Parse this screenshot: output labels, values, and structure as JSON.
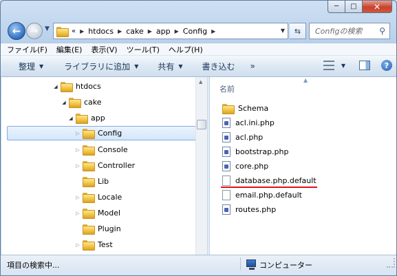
{
  "window": {
    "minimize_label": "─",
    "maximize_label": "□",
    "close_label": "✕"
  },
  "nav": {
    "back_icon": "left-arrow-icon",
    "forward_icon": "right-arrow-icon",
    "address": {
      "overflow": "«",
      "segments": [
        "htdocs",
        "cake",
        "app",
        "Config"
      ]
    },
    "search_placeholder": "Configの検索"
  },
  "menubar": {
    "items": [
      "ファイル(F)",
      "編集(E)",
      "表示(V)",
      "ツール(T)",
      "ヘルプ(H)"
    ]
  },
  "toolbar": {
    "organize": "整理",
    "add_to_library": "ライブラリに追加",
    "share": "共有",
    "burn": "書き込む",
    "more": "»"
  },
  "tree": {
    "items": [
      {
        "label": "htdocs",
        "expanded": true
      },
      {
        "label": "cake",
        "expanded": true
      },
      {
        "label": "app",
        "expanded": true
      },
      {
        "label": "Config",
        "expanded": false,
        "selected": true
      },
      {
        "label": "Console",
        "expanded": false
      },
      {
        "label": "Controller",
        "expanded": false
      },
      {
        "label": "Lib",
        "expanded": null
      },
      {
        "label": "Locale",
        "expanded": false
      },
      {
        "label": "Model",
        "expanded": false
      },
      {
        "label": "Plugin",
        "expanded": null
      },
      {
        "label": "Test",
        "expanded": false
      }
    ]
  },
  "content": {
    "column_name": "名前",
    "files": [
      {
        "name": "Schema",
        "type": "folder"
      },
      {
        "name": "acl.ini.php",
        "type": "php"
      },
      {
        "name": "acl.php",
        "type": "php"
      },
      {
        "name": "bootstrap.php",
        "type": "php"
      },
      {
        "name": "core.php",
        "type": "php"
      },
      {
        "name": "database.php.default",
        "type": "file",
        "highlighted": true
      },
      {
        "name": "email.php.default",
        "type": "file"
      },
      {
        "name": "routes.php",
        "type": "php"
      }
    ]
  },
  "status": {
    "text": "項目の検索中...",
    "location": "コンピューター"
  }
}
